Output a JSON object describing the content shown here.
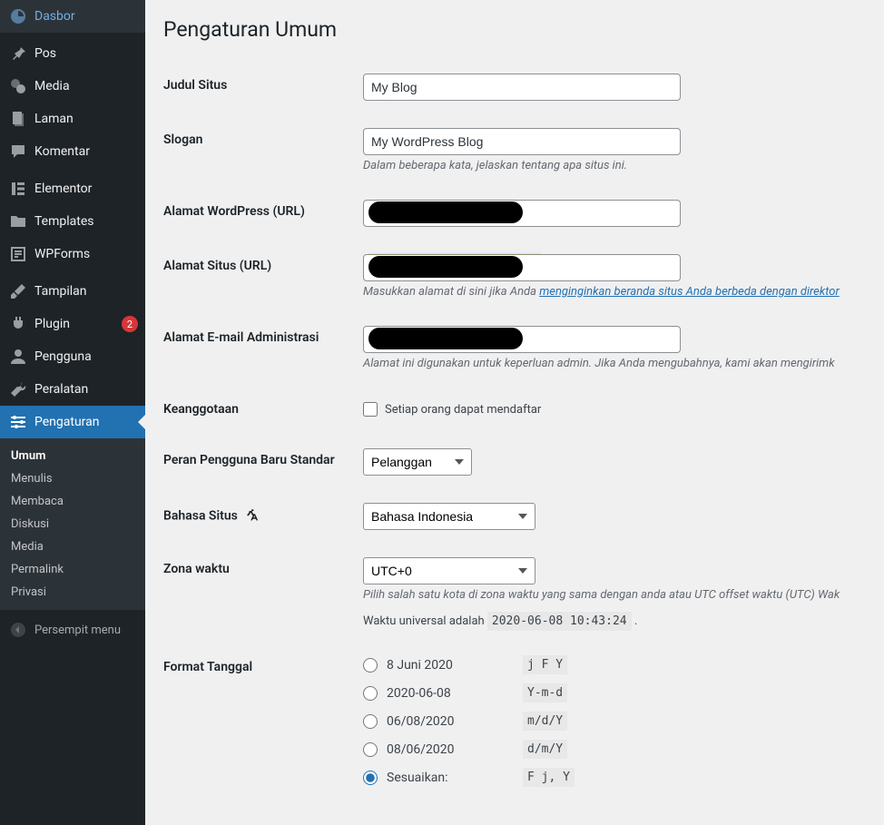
{
  "sidebar": {
    "items": [
      {
        "label": "Dasbor"
      },
      {
        "label": "Pos"
      },
      {
        "label": "Media"
      },
      {
        "label": "Laman"
      },
      {
        "label": "Komentar"
      },
      {
        "label": "Elementor"
      },
      {
        "label": "Templates"
      },
      {
        "label": "WPForms"
      },
      {
        "label": "Tampilan"
      },
      {
        "label": "Plugin",
        "badge": "2"
      },
      {
        "label": "Pengguna"
      },
      {
        "label": "Peralatan"
      },
      {
        "label": "Pengaturan"
      }
    ],
    "submenu": [
      "Umum",
      "Menulis",
      "Membaca",
      "Diskusi",
      "Media",
      "Permalink",
      "Privasi"
    ],
    "collapse": "Persempit menu"
  },
  "page": {
    "title": "Pengaturan Umum",
    "fields": {
      "site_title_label": "Judul Situs",
      "site_title_value": "My Blog",
      "tagline_label": "Slogan",
      "tagline_value": "My WordPress Blog",
      "tagline_desc": "Dalam beberapa kata, jelaskan tentang apa situs ini.",
      "wp_url_label": "Alamat WordPress (URL)",
      "site_url_label": "Alamat Situs (URL)",
      "site_url_desc_prefix": "Masukkan alamat di sini jika Anda ",
      "site_url_desc_link": "menginginkan beranda situs Anda berbeda dengan direktor",
      "admin_email_label": "Alamat E-mail Administrasi",
      "admin_email_desc": "Alamat ini digunakan untuk keperluan admin. Jika Anda mengubahnya, kami akan mengirimk",
      "membership_label": "Keanggotaan",
      "membership_checkbox": "Setiap orang dapat mendaftar",
      "default_role_label": "Peran Pengguna Baru Standar",
      "default_role_value": "Pelanggan",
      "language_label": "Bahasa Situs",
      "language_value": "Bahasa Indonesia",
      "timezone_label": "Zona waktu",
      "timezone_value": "UTC+0",
      "timezone_desc": "Pilih salah satu kota di zona waktu yang sama dengan anda atau UTC offset waktu (UTC) Wak",
      "utc_line_prefix": "Waktu universal adalah ",
      "utc_time": "2020-06-08 10:43:24",
      "date_format_label": "Format Tanggal",
      "date_options": [
        {
          "label": "8 Juni 2020",
          "code": "j F Y"
        },
        {
          "label": "2020-06-08",
          "code": "Y-m-d"
        },
        {
          "label": "06/08/2020",
          "code": "m/d/Y"
        },
        {
          "label": "08/06/2020",
          "code": "d/m/Y"
        },
        {
          "label": "Sesuaikan:",
          "code": "F j, Y"
        }
      ]
    }
  }
}
